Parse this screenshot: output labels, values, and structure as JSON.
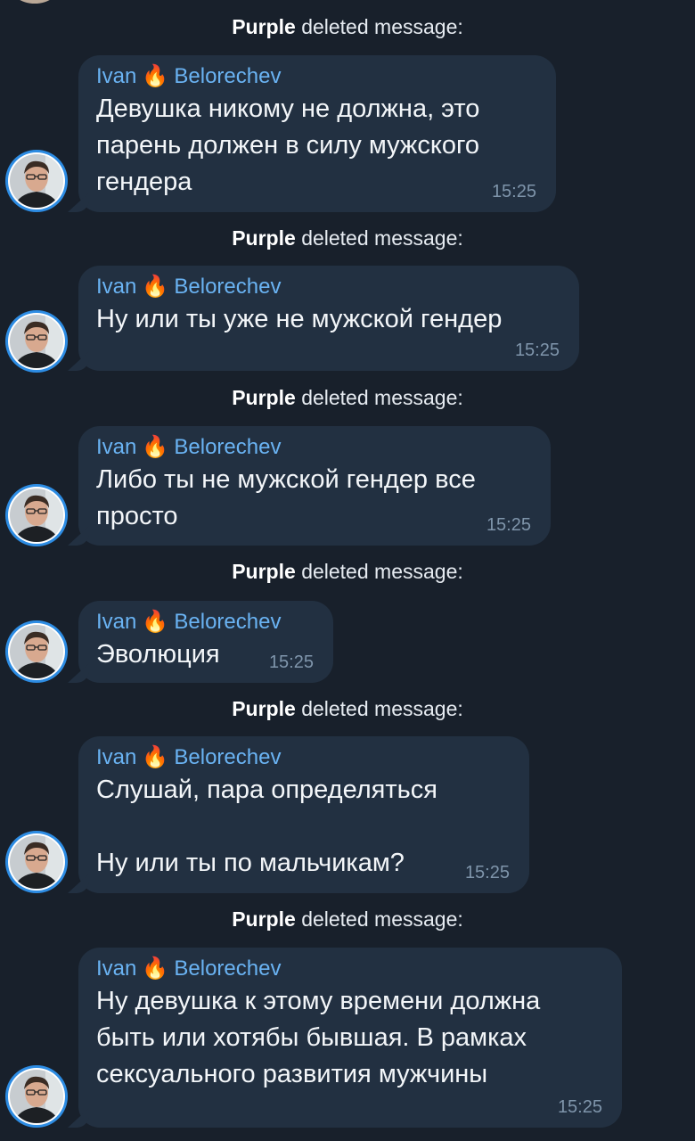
{
  "service_message": {
    "actor": "Purple",
    "action": "deleted message:"
  },
  "sender": {
    "first": "Ivan",
    "last": "Belorechev",
    "emoji": "🔥"
  },
  "messages": [
    {
      "text": "Девушка никому не должна, это\nпарень должен в силу мужского\nгендера",
      "time": "15:25"
    },
    {
      "text": "Ну или ты уже не мужской гендер",
      "time": "15:25"
    },
    {
      "text": "Либо ты не мужской гендер все\nпросто",
      "time": "15:25"
    },
    {
      "text": "Эволюция",
      "time": "15:25"
    },
    {
      "text": "Слушай, пара определяться\n\nНу или ты по мальчикам?",
      "time": "15:25"
    },
    {
      "text": "Ну девушка к этому времени должна\nбыть или хотябы бывшая. В рамках\nсексуального развития мужчины",
      "time": "15:25"
    }
  ],
  "colors": {
    "background": "#18202b",
    "bubble": "#223041",
    "sender_name": "#6ab3f3",
    "message_text": "#f3f6f9",
    "timestamp": "#7f95ab",
    "avatar_ring": "#2d8ce3"
  }
}
